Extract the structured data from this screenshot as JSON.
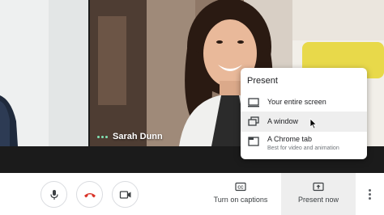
{
  "participant": {
    "name": "Sarah Dunn"
  },
  "present_menu": {
    "title": "Present",
    "items": [
      {
        "label": "Your entire screen",
        "icon": "monitor-icon"
      },
      {
        "label": "A window",
        "icon": "window-icon"
      },
      {
        "label": "A Chrome tab",
        "sublabel": "Best for video and animation",
        "icon": "browser-tab-icon"
      }
    ]
  },
  "controls": {
    "mic": {
      "icon": "microphone-icon"
    },
    "hangup": {
      "icon": "hang-up-icon",
      "color": "#d93025"
    },
    "camera": {
      "icon": "video-camera-icon"
    },
    "captions_label": "Turn on captions",
    "present_label": "Present now"
  },
  "colors": {
    "accent_speaking": "#81e3b4",
    "hangup_red": "#d93025"
  }
}
